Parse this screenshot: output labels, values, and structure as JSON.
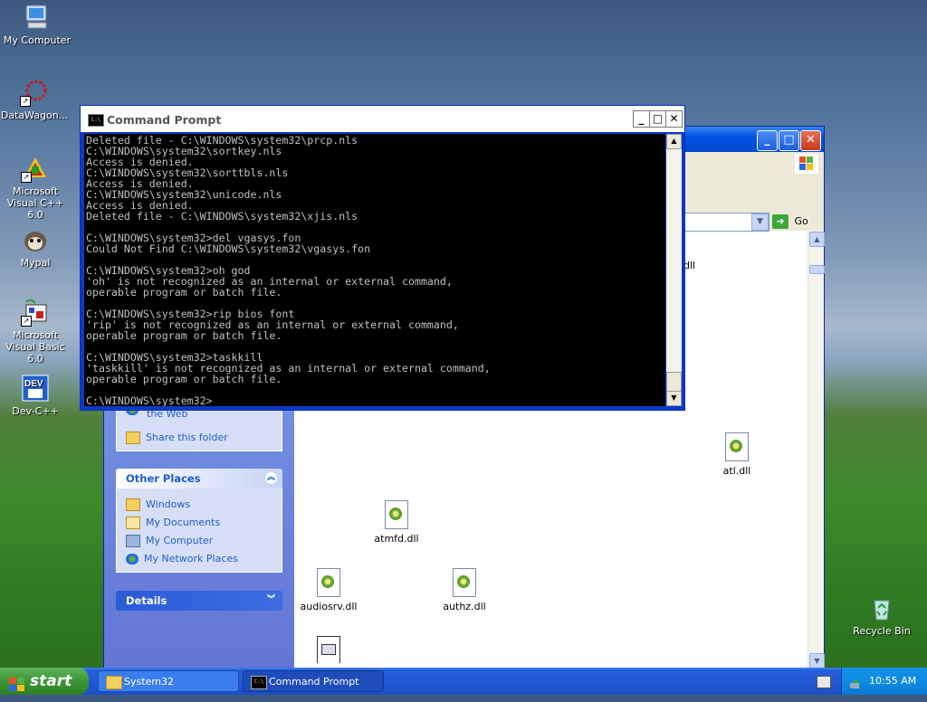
{
  "desktop": {
    "icons": [
      {
        "label": "My Computer"
      },
      {
        "label": "DataWagon..."
      },
      {
        "label": "Microsoft Visual C++ 6.0"
      },
      {
        "label": "Mypal"
      },
      {
        "label": "Microsoft Visual Basic 6.0"
      },
      {
        "label": "Dev-C++"
      },
      {
        "label": "Recycle Bin"
      }
    ]
  },
  "explorer": {
    "address_go": "Go",
    "tasks": {
      "publish_label": "Publish this folder to the Web",
      "share_label": "Share this folder"
    },
    "other_places": {
      "title": "Other Places",
      "items": [
        "Windows",
        "My Documents",
        "My Computer",
        "My Network Places"
      ]
    },
    "details": {
      "title": "Details"
    },
    "files": [
      {
        "name": "atl.dll"
      },
      {
        "name": "atmfd.dll"
      },
      {
        "name": "audiosrv.dll"
      },
      {
        "name": "authz.dll"
      }
    ],
    "partial_label": "dll"
  },
  "cmd": {
    "title": "Command Prompt",
    "icon_text": "C:\\",
    "console_text": "Deleted file - C:\\WINDOWS\\system32\\prcp.nls\nC:\\WINDOWS\\system32\\sortkey.nls\nAccess is denied.\nC:\\WINDOWS\\system32\\sorttbls.nls\nAccess is denied.\nC:\\WINDOWS\\system32\\unicode.nls\nAccess is denied.\nDeleted file - C:\\WINDOWS\\system32\\xjis.nls\n\nC:\\WINDOWS\\system32>del vgasys.fon\nCould Not Find C:\\WINDOWS\\system32\\vgasys.fon\n\nC:\\WINDOWS\\system32>oh god\n'oh' is not recognized as an internal or external command,\noperable program or batch file.\n\nC:\\WINDOWS\\system32>rip bios font\n'rip' is not recognized as an internal or external command,\noperable program or batch file.\n\nC:\\WINDOWS\\system32>taskkill\n'taskkill' is not recognized as an internal or external command,\noperable program or batch file.\n\nC:\\WINDOWS\\system32>"
  },
  "taskbar": {
    "start_label": "start",
    "buttons": [
      {
        "label": "System32"
      },
      {
        "label": "Command Prompt"
      }
    ],
    "clock": "10:55 AM"
  }
}
